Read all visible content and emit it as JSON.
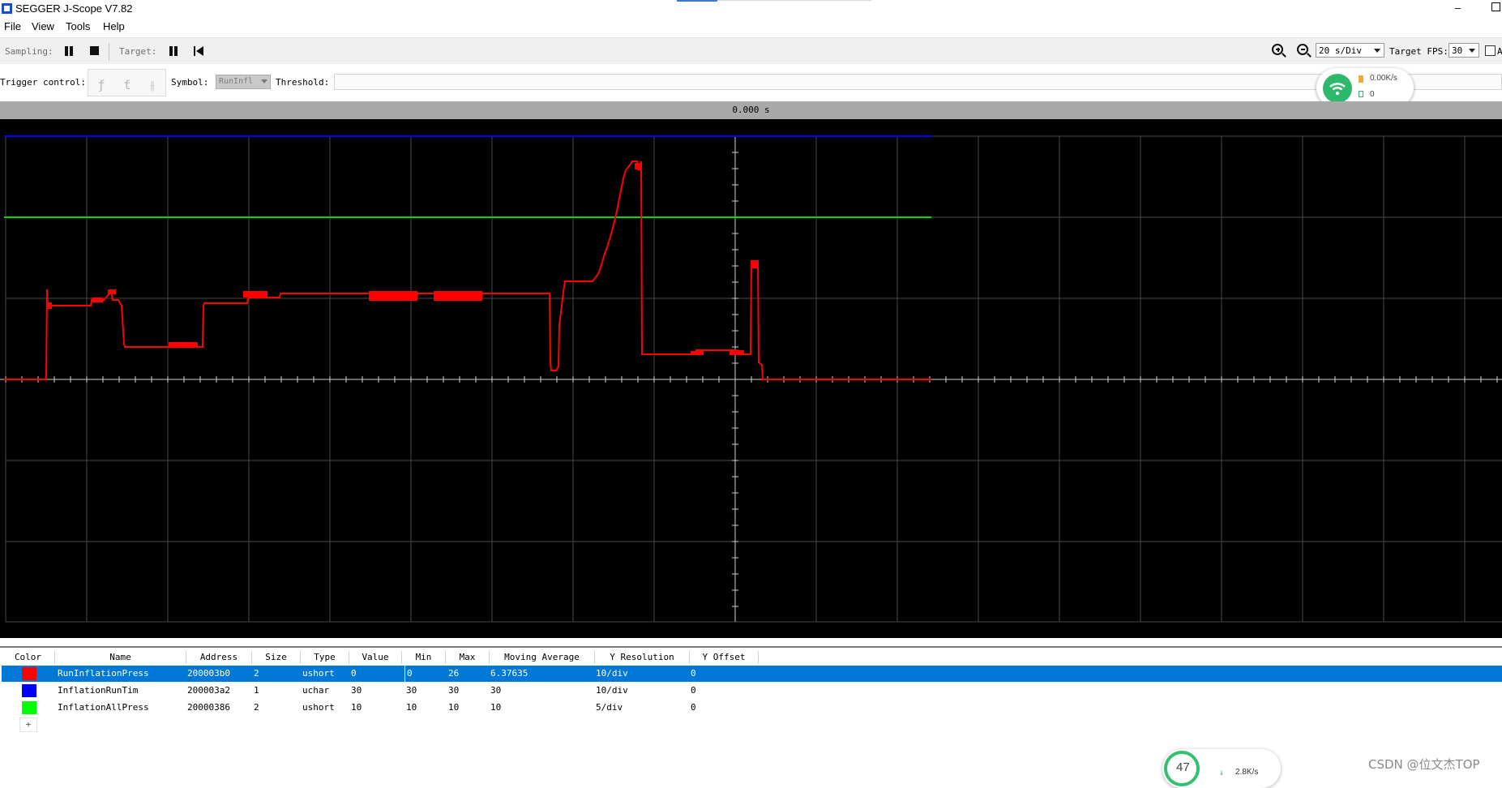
{
  "window": {
    "title": "SEGGER J-Scope V7.82",
    "min_glyph": "–"
  },
  "menu": [
    "File",
    "View",
    "Tools",
    "Help"
  ],
  "toolbar": {
    "sampling_label": "Sampling:",
    "target_label": "Target:",
    "time_div": "20 s/Div",
    "target_fps_label": "Target FPS:",
    "target_fps": "30",
    "trailing_checkbox_text": "A"
  },
  "trigger": {
    "label": "Trigger control:",
    "buttons": [
      "ƒ",
      "ƭ",
      "⫲"
    ],
    "symbol_label": "Symbol:",
    "symbol_value": "RunInfl",
    "threshold_label": "Threshold:"
  },
  "net_widget": {
    "speed": "0.00K/s",
    "count": "0"
  },
  "timebar": {
    "time": "0.000 s"
  },
  "table": {
    "headers": [
      "Color",
      "Name",
      "Address",
      "Size",
      "Type",
      "Value",
      "Min",
      "Max",
      "Moving Average",
      "Y Resolution",
      "Y Offset"
    ],
    "rows": [
      {
        "color": "#ff0000",
        "name": "RunInflationPress",
        "address": "200003b0",
        "size": "2",
        "type": "ushort",
        "value": "0",
        "min": "0",
        "max": "26",
        "avg": "6.37635",
        "yres": "10/div",
        "yoff": "0",
        "selected": true
      },
      {
        "color": "#0000ff",
        "name": "InflationRunTim",
        "address": "200003a2",
        "size": "1",
        "type": "uchar",
        "value": "30",
        "min": "30",
        "max": "30",
        "avg": "30",
        "yres": "10/div",
        "yoff": "0",
        "selected": false
      },
      {
        "color": "#00ff00",
        "name": "InflationAllPress",
        "address": "20000386",
        "size": "2",
        "type": "ushort",
        "value": "10",
        "min": "10",
        "max": "10",
        "avg": "10",
        "yres": "5/div",
        "yoff": "0",
        "selected": false
      }
    ],
    "add_label": "+"
  },
  "cpu_widget": {
    "value": "47",
    "speed": "2.8K/s"
  },
  "watermark": "CSDN @位文杰TOP",
  "colors": {
    "scope_bg": "#000000",
    "grid": "#4a4a4a",
    "axis": "#d0d0d0",
    "selection": "#0078d7"
  }
}
